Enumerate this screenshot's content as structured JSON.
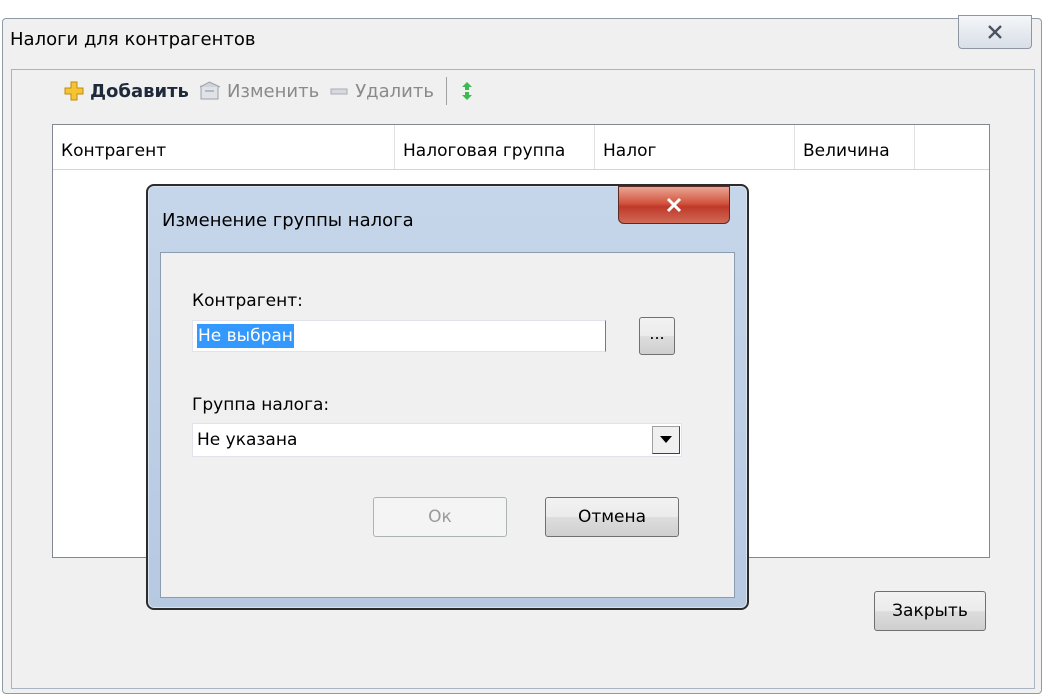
{
  "main_window": {
    "title": "Налоги для контрагентов",
    "toolbar": {
      "add_label": "Добавить",
      "edit_label": "Изменить",
      "delete_label": "Удалить"
    },
    "grid": {
      "columns": [
        "Контрагент",
        "Налоговая группа",
        "Налог",
        "Величина",
        ""
      ]
    },
    "close_button_label": "Закрыть"
  },
  "dialog": {
    "title": "Изменение группы налога",
    "counterparty_label": "Контрагент:",
    "counterparty_value": "Не выбран",
    "browse_label": "...",
    "tax_group_label": "Группа налога:",
    "tax_group_value": "Не указана",
    "ok_label": "Ок",
    "cancel_label": "Отмена"
  },
  "colors": {
    "selection": "#3399ff",
    "dialog_frame": "#b6c9e1",
    "close_red": "#c0392b"
  },
  "icons": [
    "plus-icon",
    "edit-icon",
    "minus-icon",
    "refresh-icon",
    "close-icon",
    "dropdown-arrow-icon"
  ]
}
